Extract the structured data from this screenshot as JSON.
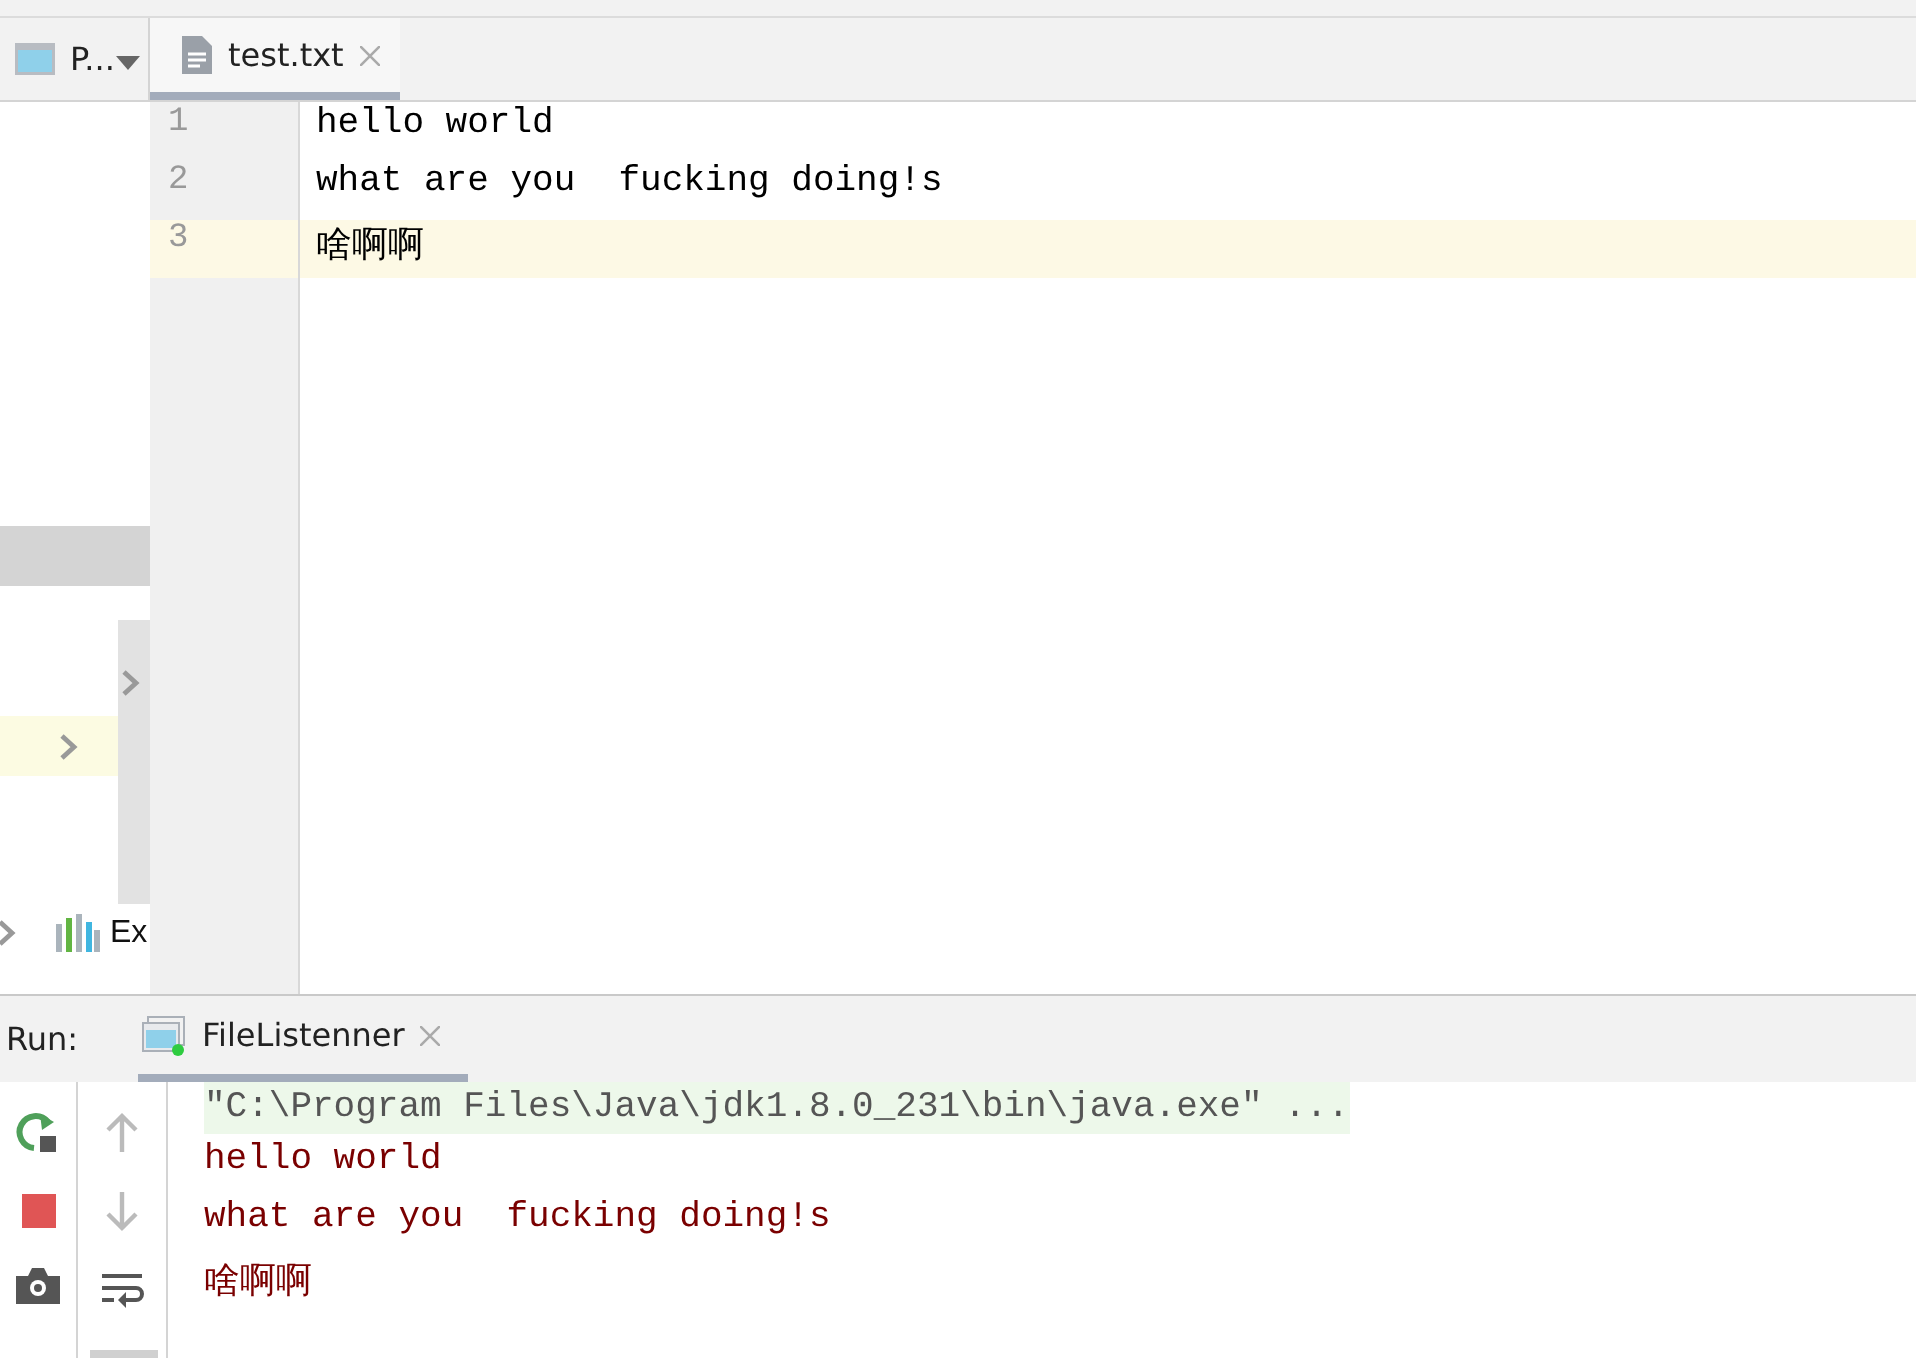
{
  "project_panel": {
    "label": "P...",
    "rows": [
      {
        "kind": "bar",
        "selected": false
      },
      {
        "kind": "chevron",
        "selected": true
      }
    ],
    "items": [
      {
        "label": "Ex"
      }
    ]
  },
  "editor": {
    "tabs": [
      {
        "label": "test.txt",
        "selected": true
      }
    ],
    "lines": [
      {
        "number": "1",
        "text": "hello world",
        "current": false
      },
      {
        "number": "2",
        "text": "what are you  fucking doing!s",
        "current": false
      },
      {
        "number": "3",
        "text": "啥啊啊",
        "current": true
      }
    ]
  },
  "run_panel": {
    "label": "Run:",
    "tabs": [
      {
        "label": "FileListenner",
        "selected": true
      }
    ],
    "console": [
      {
        "kind": "command",
        "text": "\"C:\\Program Files\\Java\\jdk1.8.0_231\\bin\\java.exe\" ..."
      },
      {
        "kind": "output",
        "text": "hello world"
      },
      {
        "kind": "output",
        "text": "what are you  fucking doing!s"
      },
      {
        "kind": "output",
        "text": "啥啊啊"
      }
    ]
  }
}
